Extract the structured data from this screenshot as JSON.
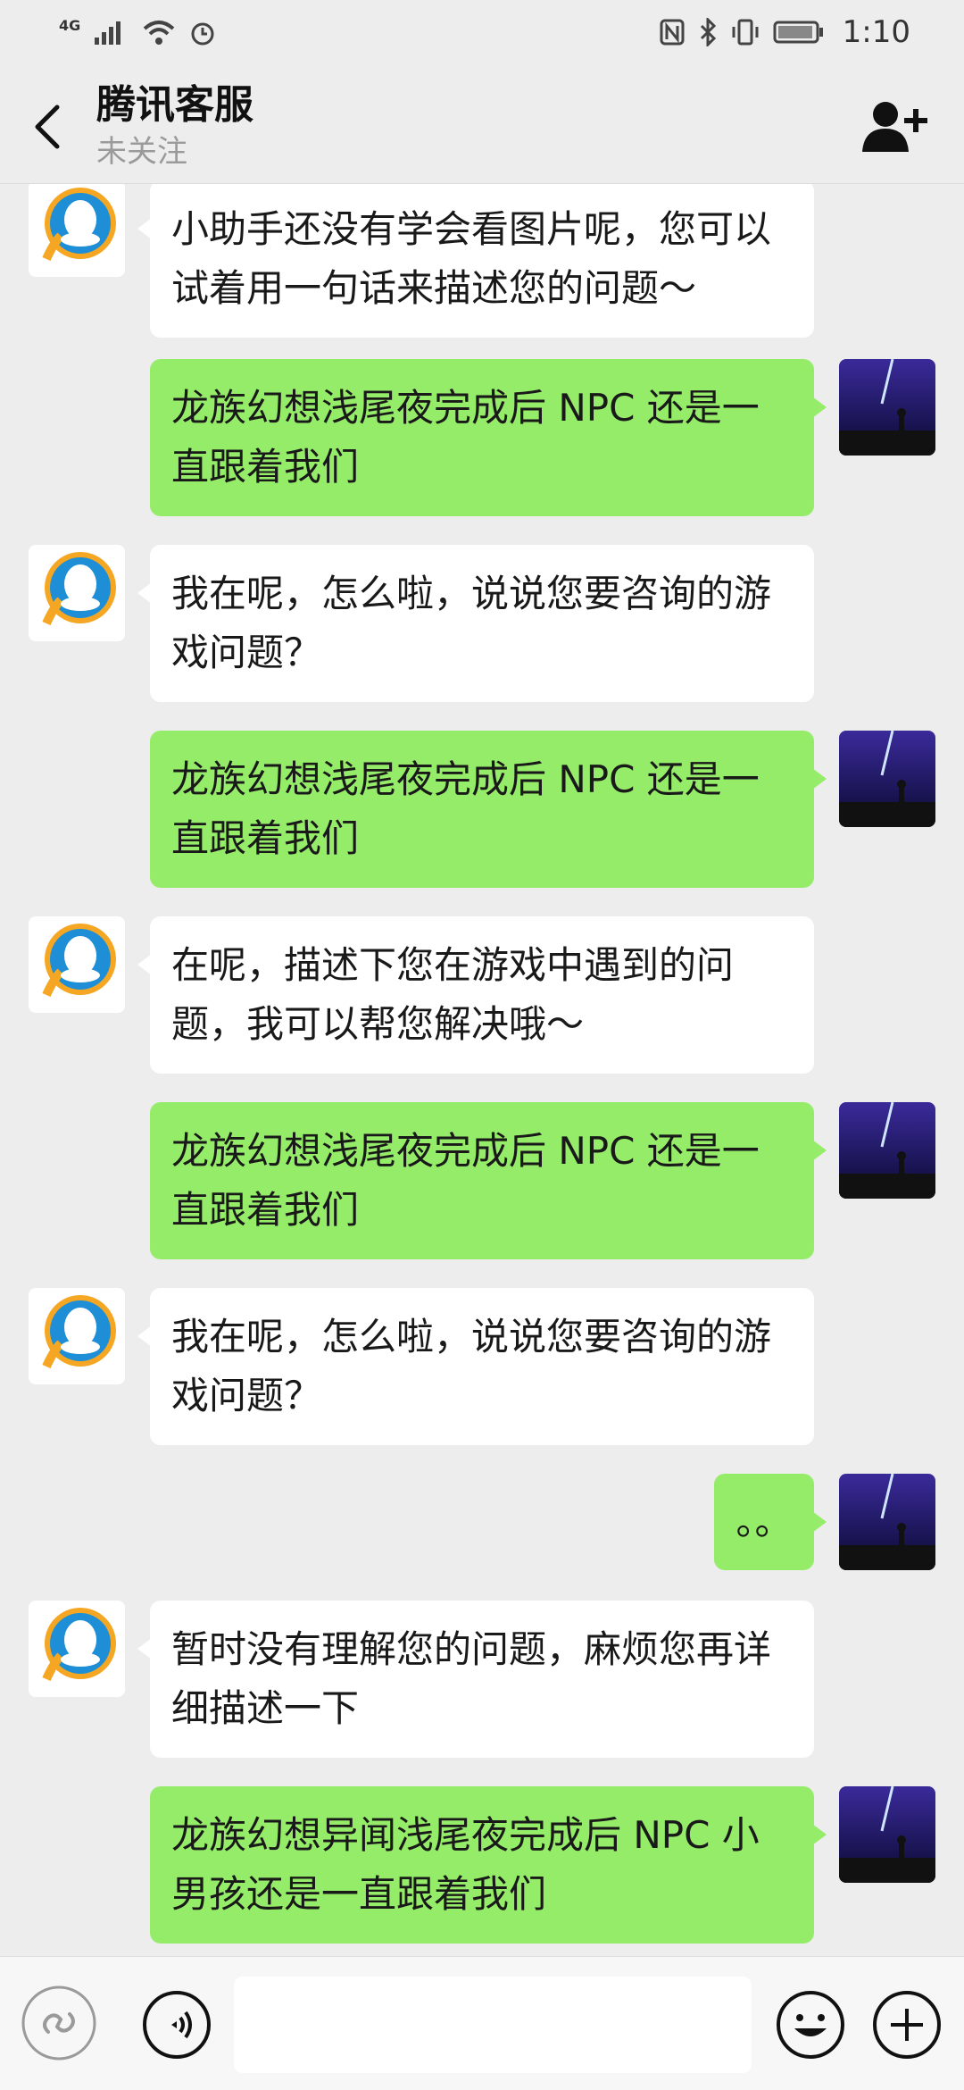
{
  "status_bar": {
    "network": "4G",
    "time": "1:10"
  },
  "header": {
    "title": "腾讯客服",
    "subtitle": "未关注"
  },
  "messages": [
    {
      "from": "bot",
      "text": "小助手还没有学会看图片呢，您可以试着用一句话来描述您的问题～"
    },
    {
      "from": "me",
      "text": "龙族幻想浅尾夜完成后 NPC 还是一直跟着我们"
    },
    {
      "from": "bot",
      "text": "我在呢，怎么啦，说说您要咨询的游戏问题？"
    },
    {
      "from": "me",
      "text": "龙族幻想浅尾夜完成后 NPC 还是一直跟着我们"
    },
    {
      "from": "bot",
      "text": "在呢，描述下您在游戏中遇到的问题，我可以帮您解决哦～"
    },
    {
      "from": "me",
      "text": "龙族幻想浅尾夜完成后 NPC 还是一直跟着我们"
    },
    {
      "from": "bot",
      "text": "我在呢，怎么啦，说说您要咨询的游戏问题？"
    },
    {
      "from": "me",
      "text": "。。"
    },
    {
      "from": "bot",
      "text": "暂时没有理解您的问题，麻烦您再详细描述一下"
    },
    {
      "from": "me",
      "text": "龙族幻想异闻浅尾夜完成后 NPC 小男孩还是一直跟着我们"
    }
  ],
  "input": {
    "value": ""
  },
  "icons": {
    "back": "chevron-left-icon",
    "add_friend": "add-user-icon",
    "mini_program": "mini-program-icon",
    "voice": "voice-icon",
    "emoji": "emoji-icon",
    "more": "plus-icon"
  },
  "colors": {
    "outgoing_bubble": "#95ec69",
    "incoming_bubble": "#ffffff",
    "background": "#ededed"
  }
}
